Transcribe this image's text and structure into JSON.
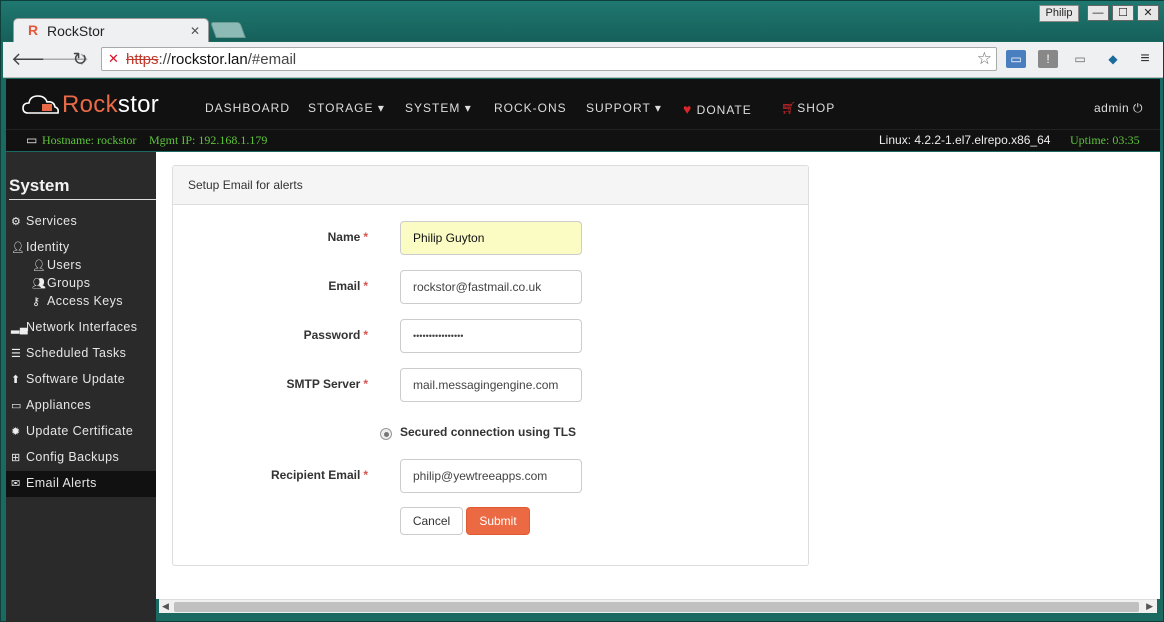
{
  "browser": {
    "tab_title": "RockStor",
    "tab_favicon": "R",
    "user_badge": "Philip",
    "url_scheme": "https",
    "url_rest": "://",
    "url_host": "rockstor.lan",
    "url_path": "/#email"
  },
  "nav": {
    "brand": "Rockstor",
    "items": [
      {
        "label": "DASHBOARD"
      },
      {
        "label": "STORAGE"
      },
      {
        "label": "SYSTEM"
      },
      {
        "label": "ROCK-ONS"
      },
      {
        "label": "SUPPORT"
      },
      {
        "label": "DONATE"
      },
      {
        "label": "SHOP"
      }
    ],
    "user": "admin"
  },
  "info": {
    "hostname": "Hostname: rockstor",
    "mgmt_ip": "Mgmt IP: 192.168.1.179",
    "linux": "Linux: 4.2.2-1.el7.elrepo.x86_64",
    "uptime": "Uptime: 03:35"
  },
  "sidebar": {
    "title": "System",
    "items": [
      {
        "label": "Services",
        "icon": "gear-icon"
      },
      {
        "label": "Identity",
        "icon": "user-icon"
      },
      {
        "label": "Users",
        "icon": "user-icon"
      },
      {
        "label": "Groups",
        "icon": "users-icon"
      },
      {
        "label": "Access Keys",
        "icon": "key-icon"
      },
      {
        "label": "Network Interfaces",
        "icon": "signal-icon"
      },
      {
        "label": "Scheduled Tasks",
        "icon": "tasks-icon"
      },
      {
        "label": "Software Update",
        "icon": "arrow-up-icon"
      },
      {
        "label": "Appliances",
        "icon": "monitor-icon"
      },
      {
        "label": "Update Certificate",
        "icon": "certificate-icon"
      },
      {
        "label": "Config Backups",
        "icon": "sitemap-icon"
      },
      {
        "label": "Email Alerts",
        "icon": "envelope-icon"
      }
    ],
    "selected": "Email Alerts"
  },
  "form": {
    "panel_title": "Setup Email for alerts",
    "name_label": "Name",
    "name_value": "Philip Guyton",
    "email_label": "Email",
    "email_value": "rockstor@fastmail.co.uk",
    "password_label": "Password",
    "password_value": "••••••••••••••••",
    "smtp_label": "SMTP Server",
    "smtp_value": "mail.messagingengine.com",
    "tls_label": "Secured connection using TLS",
    "recipient_label": "Recipient Email",
    "recipient_value": "philip@yewtreeapps.com",
    "required_mark": "*",
    "cancel": "Cancel",
    "submit": "Submit"
  },
  "colors": {
    "accent": "#ec6a43",
    "info_green": "#5ec43c",
    "nav_bg": "#111111",
    "sidebar_bg": "#2a2a2a"
  }
}
